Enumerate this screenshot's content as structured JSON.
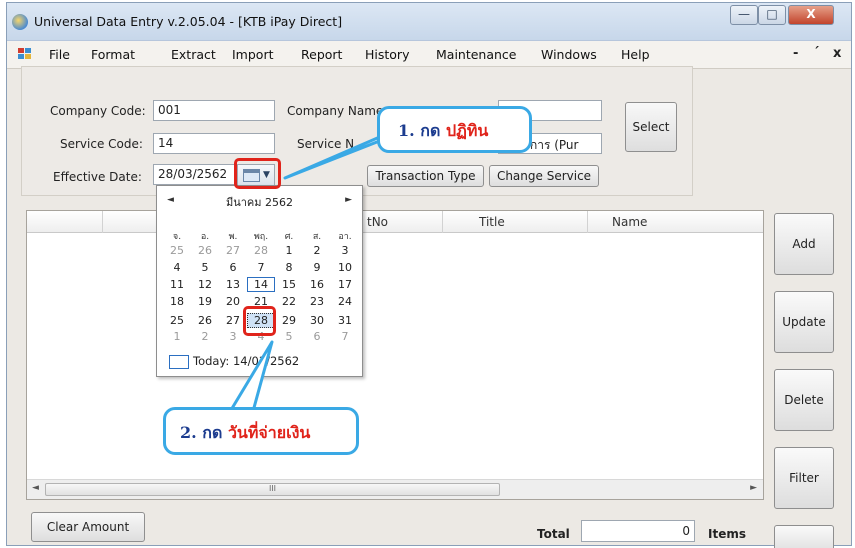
{
  "window": {
    "title": "Universal Data Entry v.2.05.04 - [KTB iPay Direct]",
    "controls": {
      "minimize": "—",
      "maximize": "□",
      "close": "X"
    }
  },
  "menu": {
    "items": [
      "File",
      "Format",
      "Extract",
      "Import",
      "Report",
      "History",
      "Maintenance",
      "Windows",
      "Help"
    ],
    "mdi_controls": {
      "minimize": "-",
      "restore": "´",
      "close": "x"
    }
  },
  "form": {
    "company_code_label": "Company Code:",
    "company_code_value": "001",
    "company_name_label": "Company Name",
    "service_code_label": "Service Code:",
    "service_code_value": "14",
    "service_name_label": "Service N",
    "service_name_value": "ระบริการ (Pur",
    "effective_date_label": "Effective Date:",
    "effective_date_value": "28/03/2562",
    "select_button": "Select",
    "transaction_type_button": "Transaction Type",
    "change_service_button": "Change Service"
  },
  "grid": {
    "columns": [
      "tNo",
      "Title",
      "Name"
    ],
    "scroll_left": "◄",
    "scroll_right": "►",
    "thumb_grip": "III"
  },
  "side_buttons": {
    "add": "Add",
    "update": "Update",
    "delete": "Delete",
    "filter": "Filter"
  },
  "bottom": {
    "clear_amount_button": "Clear Amount",
    "total_label": "Total",
    "total_value": "0",
    "items_label": "Items"
  },
  "calendar": {
    "prev": "◄",
    "next": "►",
    "month_title": "มีนาคม 2562",
    "weekdays": [
      "จ.",
      "อ.",
      "พ.",
      "พฤ.",
      "ศ.",
      "ส.",
      "อา."
    ],
    "weeks": [
      [
        "25",
        "26",
        "27",
        "28",
        "1",
        "2",
        "3"
      ],
      [
        "4",
        "5",
        "6",
        "7",
        "8",
        "9",
        "10"
      ],
      [
        "11",
        "12",
        "13",
        "14",
        "15",
        "16",
        "17"
      ],
      [
        "18",
        "19",
        "20",
        "21",
        "22",
        "23",
        "24"
      ],
      [
        "25",
        "26",
        "27",
        "28",
        "29",
        "30",
        "31"
      ],
      [
        "1",
        "2",
        "3",
        "4",
        "5",
        "6",
        "7"
      ]
    ],
    "today_label": "Today: 14/03/2562"
  },
  "annotations": {
    "callout1_num": "1. กด",
    "callout1_text": "ปฏิทิน",
    "callout2_num": "2. กด",
    "callout2_text": "วันที่จ่ายเงิน"
  },
  "colors": {
    "callout_border": "#3aa9e5",
    "highlight_red": "#e0241b",
    "callout_number": "#1c3c8f"
  }
}
